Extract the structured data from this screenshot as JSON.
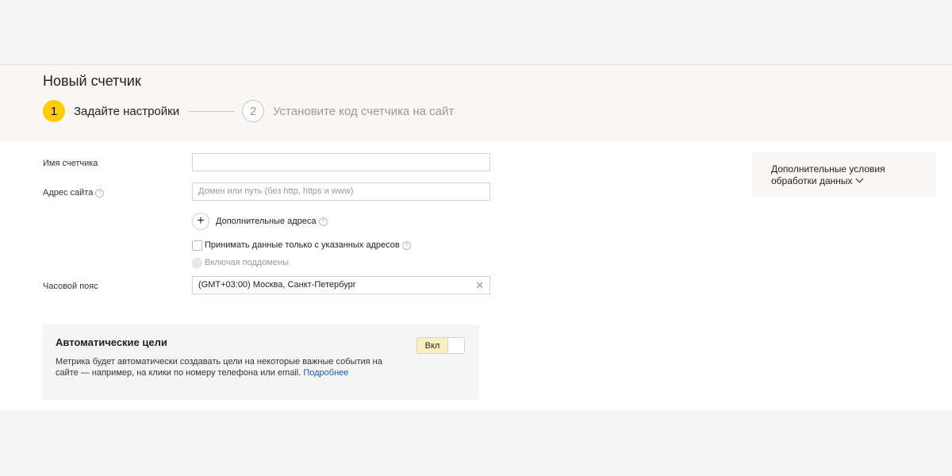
{
  "header": {
    "title": "Новый счетчик",
    "steps": [
      {
        "number": "1",
        "label": "Задайте настройки"
      },
      {
        "number": "2",
        "label": "Установите код счетчика на сайт"
      }
    ]
  },
  "form": {
    "name_label": "Имя счетчика",
    "name_value": "",
    "site_label": "Адрес сайта",
    "site_placeholder": "Домен или путь (без http, https и www)",
    "extra_addresses_label": "Дополнительные адреса",
    "only_specified_label": "Принимать данные только с указанных адресов",
    "include_subdomains_label": "Включая поддомены",
    "timezone_label": "Часовой пояс",
    "timezone_value": "(GMT+03:00) Москва, Санкт-Петербург"
  },
  "auto_goals": {
    "title": "Автоматические цели",
    "description": "Метрика будет автоматически создавать цели на некоторые важные события на сайте — например, на клики по номеру телефона или email.",
    "link": "Подробнее",
    "toggle_label": "Вкл"
  },
  "side": {
    "text": "Дополнительные условия обработки данных"
  },
  "icons": {
    "help": "help-circle-icon",
    "add": "plus-icon",
    "clear": "close-icon",
    "chevron": "chevron-down-icon"
  },
  "colors": {
    "accent": "#ffcc00",
    "link": "#1a58b5",
    "toggle_on": "#fbeec0"
  }
}
